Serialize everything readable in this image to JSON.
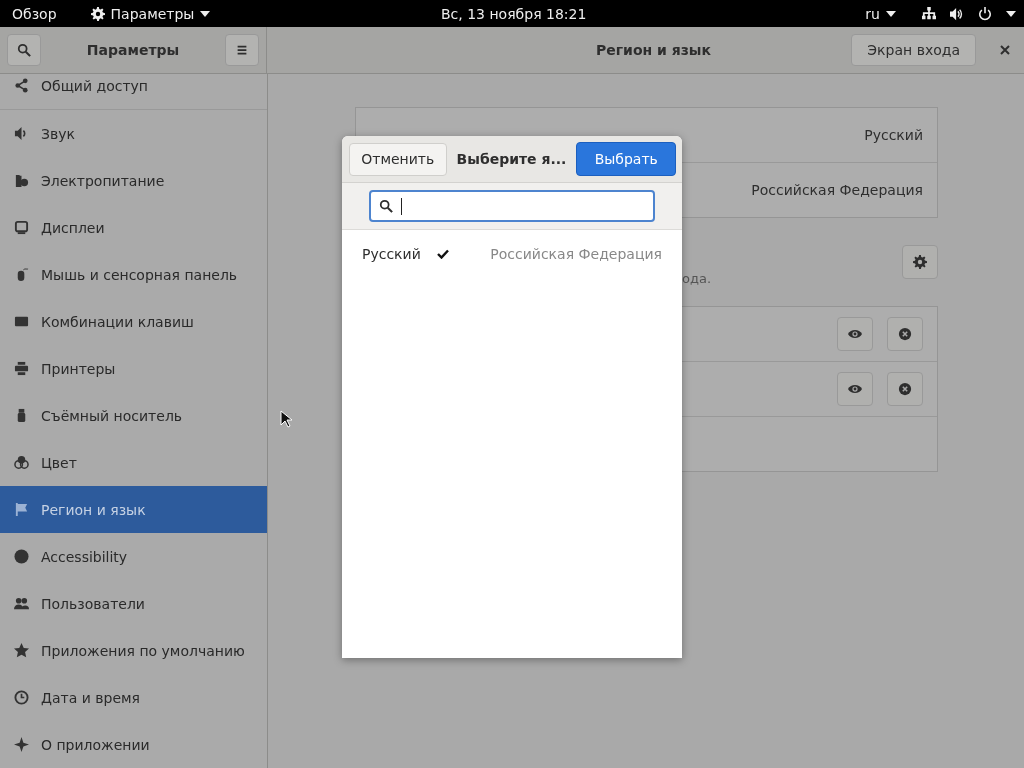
{
  "top_bar": {
    "activities": "Обзор",
    "app_menu": "Параметры",
    "clock": "Вс, 13 ноября  18:21",
    "keyboard_layout": "ru"
  },
  "header": {
    "sidebar_title": "Параметры",
    "title": "Регион и язык",
    "login_screen_button": "Экран входа"
  },
  "sidebar": {
    "items": [
      {
        "label": "Общий доступ",
        "selected": false
      },
      {
        "label": "Звук",
        "selected": false
      },
      {
        "label": "Электропитание",
        "selected": false
      },
      {
        "label": "Дисплеи",
        "selected": false
      },
      {
        "label": "Мышь и сенсорная панель",
        "selected": false
      },
      {
        "label": "Комбинации клавиш",
        "selected": false
      },
      {
        "label": "Принтеры",
        "selected": false
      },
      {
        "label": "Съёмный носитель",
        "selected": false
      },
      {
        "label": "Цвет",
        "selected": false
      },
      {
        "label": "Регион и язык",
        "selected": true
      },
      {
        "label": "Accessibility",
        "selected": false
      },
      {
        "label": "Пользователи",
        "selected": false
      },
      {
        "label": "Приложения по умолчанию",
        "selected": false
      },
      {
        "label": "Дата и время",
        "selected": false
      },
      {
        "label": "О приложении",
        "selected": false
      }
    ]
  },
  "main": {
    "language_rows": [
      {
        "value": "Русский"
      },
      {
        "value": "Российская Федерация"
      }
    ],
    "hint": "ода.",
    "input_sources": [
      {
        "kind": "source"
      },
      {
        "kind": "source"
      },
      {
        "kind": "add"
      }
    ]
  },
  "dialog": {
    "cancel_button": "Отменить",
    "title": "Выберите я...",
    "select_button": "Выбрать",
    "search": {
      "focused": true
    },
    "languages": [
      {
        "name": "Русский",
        "checked": true,
        "country": "Российская Федерация"
      }
    ]
  }
}
